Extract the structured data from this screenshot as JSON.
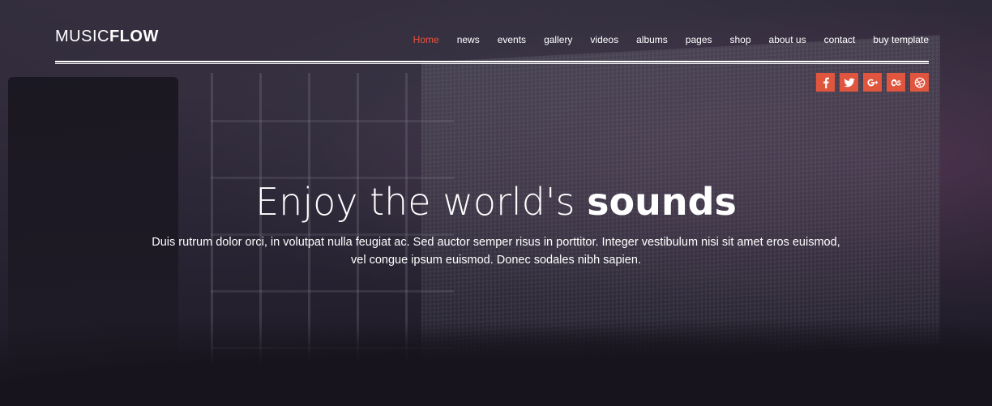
{
  "logo": {
    "light": "MUSIC",
    "bold": "FLOW"
  },
  "nav": {
    "items": [
      {
        "label": "Home",
        "active": true
      },
      {
        "label": "news"
      },
      {
        "label": "events"
      },
      {
        "label": "gallery"
      },
      {
        "label": "videos"
      },
      {
        "label": "albums"
      },
      {
        "label": "pages"
      },
      {
        "label": "shop"
      },
      {
        "label": "about us"
      },
      {
        "label": "contact"
      },
      {
        "label": "buy template"
      }
    ],
    "active_color": "#e8543f"
  },
  "social": {
    "color": "#e0553e",
    "icons": [
      "facebook-icon",
      "twitter-icon",
      "google-plus-icon",
      "lastfm-icon",
      "dribbble-icon"
    ]
  },
  "hero": {
    "headline_light": "Enjoy the world's",
    "headline_bold": "sounds",
    "subtext": "Duis rutrum dolor orci, in volutpat nulla feugiat ac. Sed auctor semper risus in porttitor. Integer vestibulum nisi sit amet eros euismod, vel congue ipsum euismod. Donec sodales nibh sapien."
  }
}
